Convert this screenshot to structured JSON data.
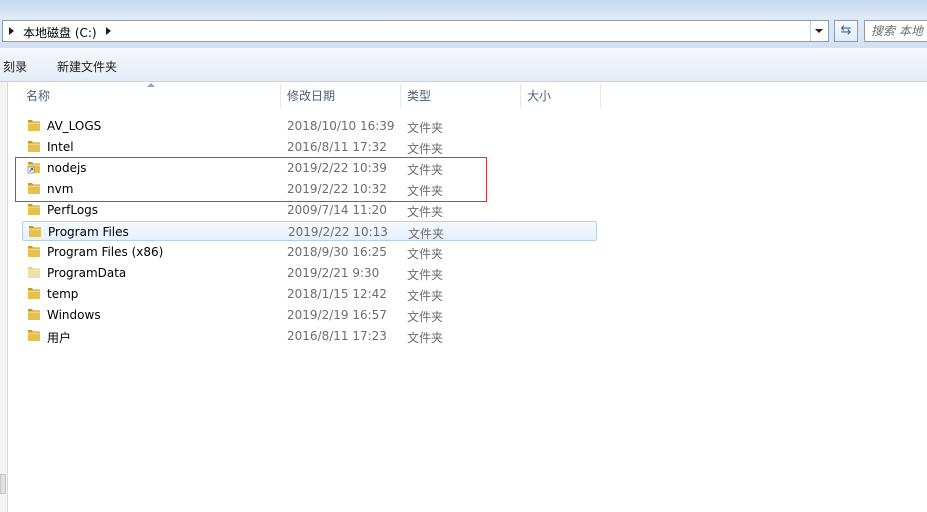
{
  "address_bar": {
    "breadcrumb": "本地磁盘 (C:)"
  },
  "search": {
    "placeholder": "搜索 本地"
  },
  "toolbar": {
    "burn_label": "刻录",
    "new_folder_label": "新建文件夹"
  },
  "columns": {
    "name": "名称",
    "date_modified": "修改日期",
    "type": "类型",
    "size": "大小"
  },
  "files": [
    {
      "name": "AV_LOGS",
      "date": "2018/10/10 16:39",
      "type": "文件夹",
      "icon": "folder-icon"
    },
    {
      "name": "Intel",
      "date": "2016/8/11 17:32",
      "type": "文件夹",
      "icon": "folder-icon"
    },
    {
      "name": "nodejs",
      "date": "2019/2/22 10:39",
      "type": "文件夹",
      "icon": "folder-shortcut-icon"
    },
    {
      "name": "nvm",
      "date": "2019/2/22 10:32",
      "type": "文件夹",
      "icon": "folder-icon"
    },
    {
      "name": "PerfLogs",
      "date": "2009/7/14 11:20",
      "type": "文件夹",
      "icon": "folder-icon"
    },
    {
      "name": "Program Files",
      "date": "2019/2/22 10:13",
      "type": "文件夹",
      "icon": "folder-icon",
      "selected": true
    },
    {
      "name": "Program Files (x86)",
      "date": "2018/9/30 16:25",
      "type": "文件夹",
      "icon": "folder-icon"
    },
    {
      "name": "ProgramData",
      "date": "2019/2/21 9:30",
      "type": "文件夹",
      "icon": "folder-hidden-icon"
    },
    {
      "name": "temp",
      "date": "2018/1/15 12:42",
      "type": "文件夹",
      "icon": "folder-icon"
    },
    {
      "name": "Windows",
      "date": "2019/2/19 16:57",
      "type": "文件夹",
      "icon": "folder-icon"
    },
    {
      "name": "用户",
      "date": "2016/8/11 17:23",
      "type": "文件夹",
      "icon": "folder-icon"
    }
  ],
  "colors": {
    "folder": "#e8c14d",
    "folder_dark": "#c99a22",
    "highlight_box": "#d9363b",
    "selection": "#b7cfeb"
  }
}
